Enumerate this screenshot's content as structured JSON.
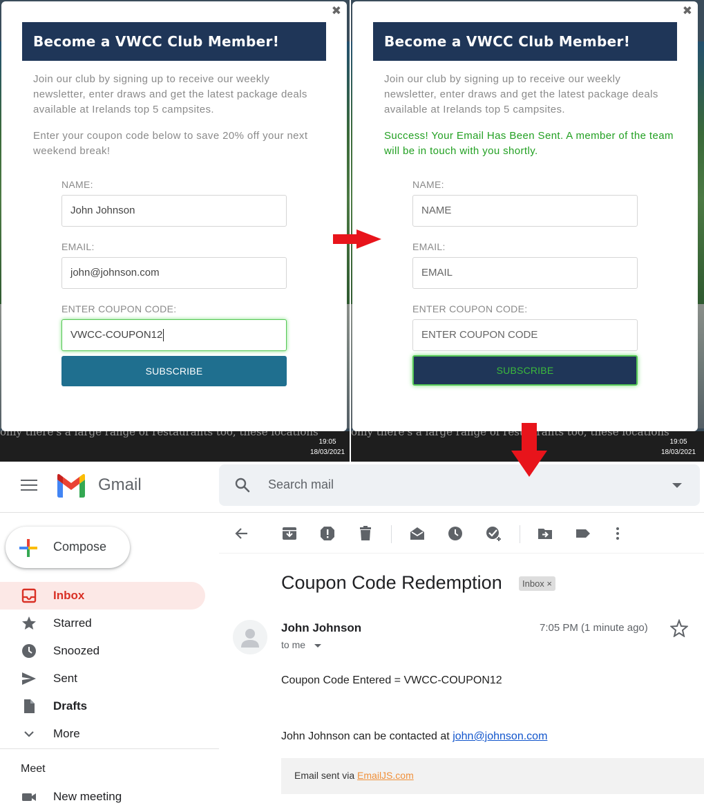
{
  "popup": {
    "title": "Become a VWCC Club Member!",
    "intro": "Join our club by signing up to receive our weekly newsletter, enter draws and get the latest package deals available at Irelands top 5 campsites.",
    "coupon_text": "Enter your coupon code below to save 20% off your next weekend break!",
    "success_text": "Success! Your Email Has Been Sent. A member of the team will be in touch with you shortly.",
    "name_label": "NAME:",
    "email_label": "EMAIL:",
    "coupon_label": "ENTER COUPON CODE:",
    "name_value": "John Johnson",
    "email_value": "john@johnson.com",
    "coupon_value": "VWCC-COUPON12",
    "name_placeholder": "NAME",
    "email_placeholder": "EMAIL",
    "coupon_placeholder": "ENTER COUPON CODE",
    "subscribe_label": "SUBSCRIBE",
    "close_glyph": "✖"
  },
  "background_text": "only there's a large range of restaurants too, these locations",
  "taskbar": {
    "time": "19:05",
    "date": "18/03/2021"
  },
  "gmail": {
    "wordmark": "Gmail",
    "search_placeholder": "Search mail",
    "compose_label": "Compose",
    "nav": [
      {
        "label": "Inbox",
        "icon": "inbox-icon"
      },
      {
        "label": "Starred",
        "icon": "star-icon"
      },
      {
        "label": "Snoozed",
        "icon": "clock-icon"
      },
      {
        "label": "Sent",
        "icon": "send-icon"
      },
      {
        "label": "Drafts",
        "icon": "draft-icon"
      },
      {
        "label": "More",
        "icon": "chevron-down-icon"
      }
    ],
    "meet_title": "Meet",
    "meet_new": "New meeting",
    "toolbar_icons": [
      "back-arrow-icon",
      "archive-icon",
      "report-spam-icon",
      "delete-icon",
      "mark-unread-icon",
      "snooze-icon",
      "add-task-icon",
      "move-to-icon",
      "label-icon",
      "more-vert-icon"
    ],
    "email": {
      "subject": "Coupon Code Redemption",
      "chip": "Inbox ×",
      "sender": "John Johnson",
      "to": "to me",
      "time": "7:05 PM (1 minute ago)",
      "body_line1": "Coupon Code Entered = VWCC-COUPON12",
      "body_contact_prefix": "John Johnson can be contacted at ",
      "body_contact_email": "john@johnson.com",
      "footer_prefix": "Email sent via ",
      "footer_link": "EmailJS.com"
    }
  },
  "colors": {
    "banner": "#1f3658",
    "subscribe_blue": "#1f6f8f",
    "success_green": "#22a022",
    "focus_green": "#55c755",
    "arrow_red": "#e8141b",
    "gmail_red": "#d93025",
    "inbox_active_bg": "#fce8e6"
  }
}
